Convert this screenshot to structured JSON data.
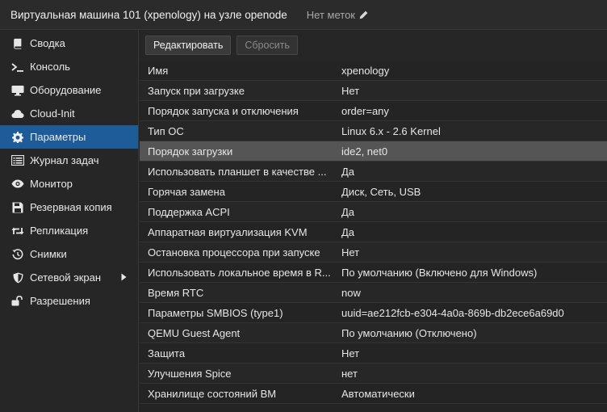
{
  "header": {
    "title": "Виртуальная машина 101 (xpenology) на узле openode",
    "tags_label": "Нет меток"
  },
  "sidebar": {
    "items": [
      {
        "label": "Сводка",
        "icon": "book-icon"
      },
      {
        "label": "Консоль",
        "icon": "terminal-icon"
      },
      {
        "label": "Оборудование",
        "icon": "monitor-icon"
      },
      {
        "label": "Cloud-Init",
        "icon": "cloud-icon"
      },
      {
        "label": "Параметры",
        "icon": "gear-icon"
      },
      {
        "label": "Журнал задач",
        "icon": "list-icon"
      },
      {
        "label": "Монитор",
        "icon": "eye-icon"
      },
      {
        "label": "Резервная копия",
        "icon": "floppy-icon"
      },
      {
        "label": "Репликация",
        "icon": "retweet-icon"
      },
      {
        "label": "Снимки",
        "icon": "history-icon"
      },
      {
        "label": "Сетевой экран",
        "icon": "shield-icon"
      },
      {
        "label": "Разрешения",
        "icon": "unlock-icon"
      }
    ],
    "active": "Параметры"
  },
  "toolbar": {
    "edit_label": "Редактировать",
    "reset_label": "Сбросить"
  },
  "options": {
    "rows": [
      {
        "key": "Имя",
        "value": "xpenology"
      },
      {
        "key": "Запуск при загрузке",
        "value": "Нет"
      },
      {
        "key": "Порядок запуска и отключения",
        "value": "order=any"
      },
      {
        "key": "Тип ОС",
        "value": "Linux 6.x - 2.6 Kernel"
      },
      {
        "key": "Порядок загрузки",
        "value": "ide2, net0"
      },
      {
        "key": "Использовать планшет в качестве ...",
        "value": "Да"
      },
      {
        "key": "Горячая замена",
        "value": "Диск, Сеть, USB"
      },
      {
        "key": "Поддержка ACPI",
        "value": "Да"
      },
      {
        "key": "Аппаратная виртуализация KVM",
        "value": "Да"
      },
      {
        "key": "Остановка процессора при запуске",
        "value": "Нет"
      },
      {
        "key": "Использовать локальное время в R...",
        "value": "По умолчанию (Включено для Windows)"
      },
      {
        "key": "Время RTC",
        "value": "now"
      },
      {
        "key": "Параметры SMBIOS (type1)",
        "value": "uuid=ae212fcb-e304-4a0a-869b-db2ece6a69d0"
      },
      {
        "key": "QEMU Guest Agent",
        "value": "По умолчанию (Отключено)"
      },
      {
        "key": "Защита",
        "value": "Нет"
      },
      {
        "key": "Улучшения Spice",
        "value": "нет"
      },
      {
        "key": "Хранилище состояний ВМ",
        "value": "Автоматически"
      }
    ],
    "selected": "Порядок загрузки"
  },
  "colors": {
    "accent": "#1e5c99",
    "background": "#242424",
    "selected_row": "#555555"
  }
}
